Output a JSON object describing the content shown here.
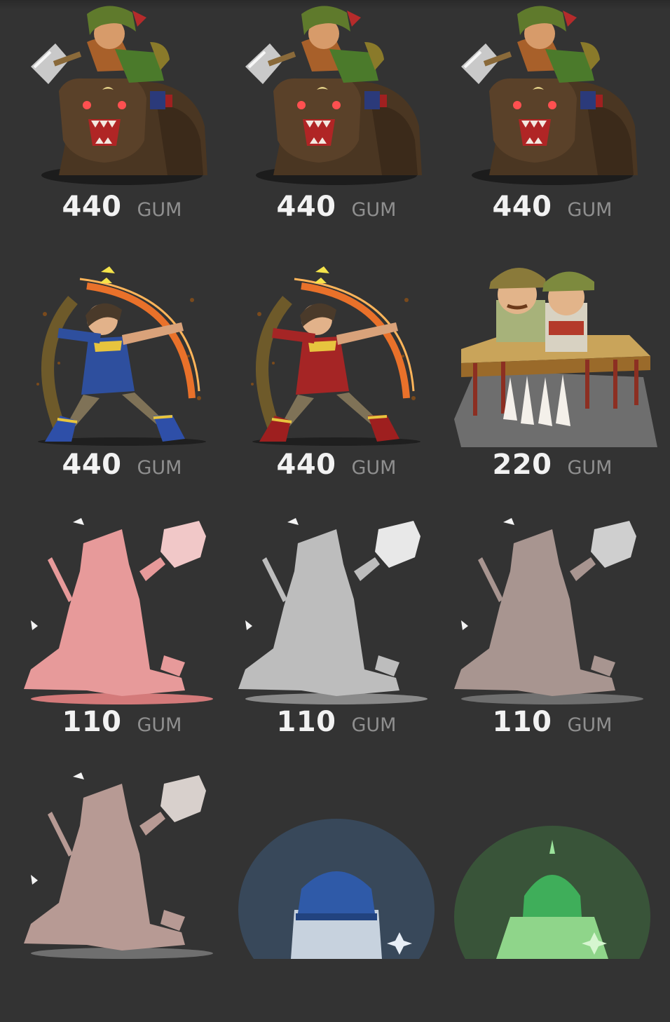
{
  "items": [
    {
      "name": "bear-rider",
      "price": "440",
      "unit": "GUM",
      "icon": "bear-rider-sprite",
      "variant": "normal"
    },
    {
      "name": "bear-rider",
      "price": "440",
      "unit": "GUM",
      "icon": "bear-rider-sprite",
      "variant": "normal"
    },
    {
      "name": "bear-rider",
      "price": "440",
      "unit": "GUM",
      "icon": "bear-rider-sprite",
      "variant": "normal"
    },
    {
      "name": "archer-blue",
      "price": "440",
      "unit": "GUM",
      "icon": "fire-archer-sprite",
      "variant": "blue"
    },
    {
      "name": "archer-red",
      "price": "440",
      "unit": "GUM",
      "icon": "fire-archer-sprite",
      "variant": "red"
    },
    {
      "name": "two-conductors",
      "price": "220",
      "unit": "GUM",
      "icon": "conductors-sprite",
      "variant": "normal"
    },
    {
      "name": "knight-silhouette-pink",
      "price": "110",
      "unit": "GUM",
      "icon": "knight-silhouette-sprite",
      "variant": "pink"
    },
    {
      "name": "knight-silhouette-grey",
      "price": "110",
      "unit": "GUM",
      "icon": "knight-silhouette-sprite",
      "variant": "grey"
    },
    {
      "name": "knight-silhouette-faded",
      "price": "110",
      "unit": "GUM",
      "icon": "knight-silhouette-sprite",
      "variant": "faded"
    },
    {
      "name": "knight-partial",
      "icon": "knight-silhouette-sprite",
      "variant": "faded-partial"
    },
    {
      "name": "blue-glow",
      "icon": "blue-helmet-sprite",
      "variant": "blue"
    },
    {
      "name": "green-glow",
      "icon": "green-dome-sprite",
      "variant": "green"
    }
  ],
  "colors": {
    "background": "#333333",
    "price": "#f2f2f2",
    "unit": "#8f8f8f"
  }
}
